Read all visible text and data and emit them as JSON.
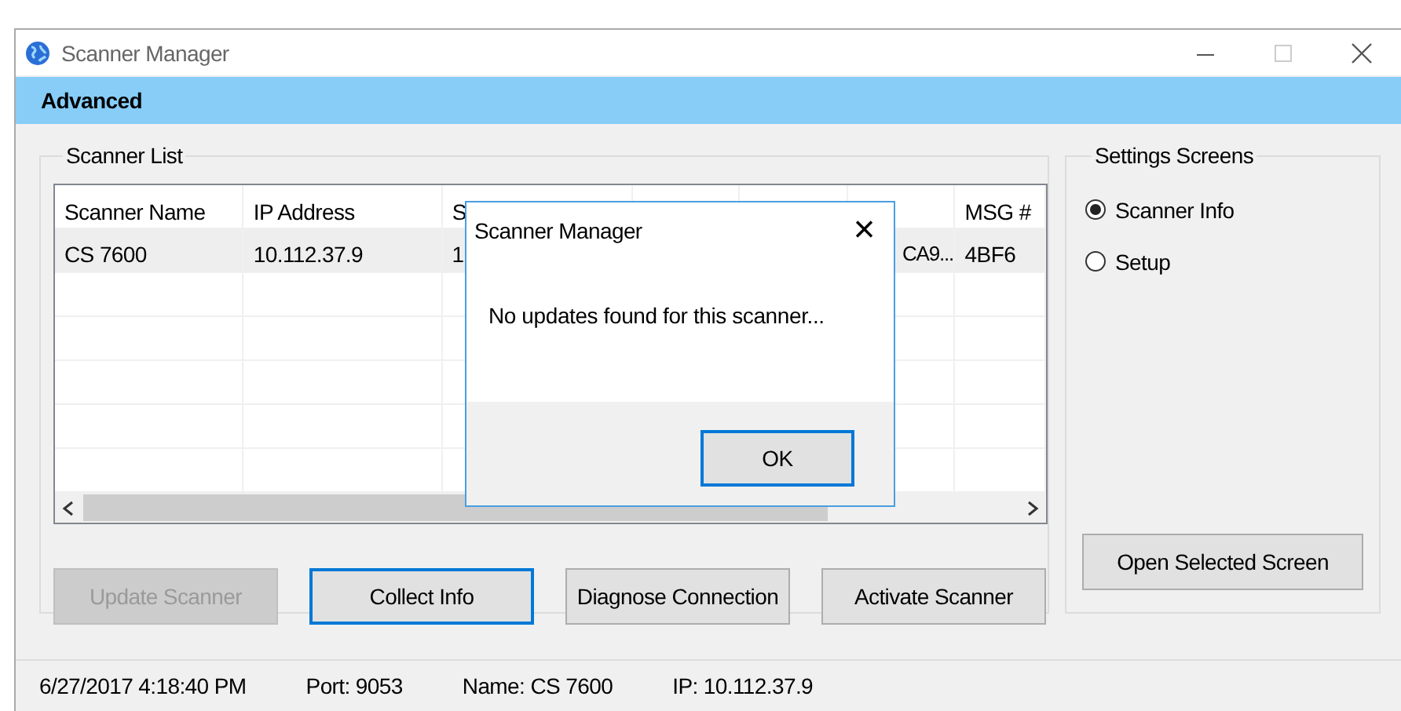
{
  "window": {
    "title": "Scanner Manager"
  },
  "header": {
    "title": "Advanced"
  },
  "scanner_list": {
    "title": "Scanner List",
    "columns": [
      "Scanner Name",
      "IP Address",
      "S",
      "",
      "",
      "",
      "MSG #"
    ],
    "rows": [
      {
        "cells": [
          "CS 7600",
          "10.112.37.9",
          "1",
          "",
          "",
          "CA9...",
          "4BF6"
        ],
        "selected": true
      }
    ],
    "buttons": [
      {
        "label": "Update Scanner",
        "disabled": true,
        "focused": false
      },
      {
        "label": "Collect Info",
        "disabled": false,
        "focused": true
      },
      {
        "label": "Diagnose Connection",
        "disabled": false,
        "focused": false
      },
      {
        "label": "Activate Scanner",
        "disabled": false,
        "focused": false
      }
    ]
  },
  "settings_screens": {
    "title": "Settings Screens",
    "options": [
      {
        "label": "Scanner Info",
        "selected": true
      },
      {
        "label": "Setup",
        "selected": false
      }
    ],
    "button": {
      "label": "Open Selected Screen"
    }
  },
  "status_bar": [
    "6/27/2017 4:18:40 PM",
    "Port: 9053",
    "Name: CS 7600",
    "IP: 10.112.37.9"
  ],
  "dialog": {
    "title": "Scanner Manager",
    "message": "No updates found for this scanner...",
    "close": "×",
    "button": {
      "label": "OK",
      "focused": true
    }
  }
}
